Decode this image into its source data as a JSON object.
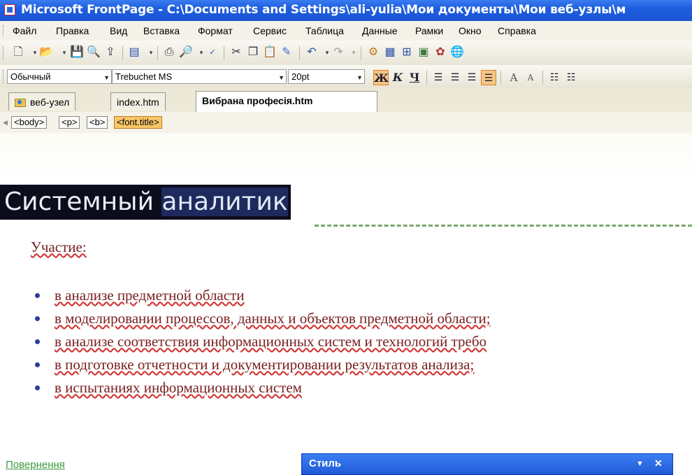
{
  "window": {
    "title": "Microsoft FrontPage - C:\\Documents and Settings\\ali-yulia\\Мои документы\\Мои веб-узлы\\м"
  },
  "menu": [
    "Файл",
    "Правка",
    "Вид",
    "Вставка",
    "Формат",
    "Сервис",
    "Таблица",
    "Данные",
    "Рамки",
    "Окно",
    "Справка"
  ],
  "toolbar_standard": {
    "icons": [
      "new-page-icon",
      "open-icon",
      "save-icon",
      "search-icon",
      "publish-icon",
      "views-icon",
      "print-icon",
      "print-preview-icon",
      "spelling-icon",
      "cut-icon",
      "copy-icon",
      "paste-icon",
      "format-painter-icon",
      "undo-icon",
      "redo-icon",
      "web-component-icon",
      "insert-table-icon",
      "layer-icon",
      "picture-icon",
      "drawing-icon",
      "hyperlink-icon"
    ]
  },
  "toolbar_formatting": {
    "style": "Обычный",
    "font": "Trebuchet MS",
    "size": "20pt",
    "bold": "Ж",
    "italic": "К",
    "underline": "Ч",
    "increase_font": "A",
    "decrease_font": "A"
  },
  "tabs": [
    {
      "label": "веб-узел"
    },
    {
      "label": "index.htm"
    },
    {
      "label": "Вибрана професія.htm"
    }
  ],
  "tags": [
    "<body>",
    "<p>",
    "<b>",
    "<font.title>"
  ],
  "document": {
    "heading_part1": "Системный ",
    "heading_part2": "аналитик",
    "participation": "Участие:",
    "bullets": [
      "в анализе предметной области",
      "в моделировании процессов, данных и объектов предметной области;",
      "в анализе соответствия информационных систем и технологий  требо",
      "в подготовке отчетности и документировании результатов анализа;",
      "в испытаниях информационных систем"
    ],
    "back_link": "Повернення"
  },
  "style_panel": {
    "title": "Стиль",
    "menu_arrow": "▼",
    "close": "✕"
  }
}
